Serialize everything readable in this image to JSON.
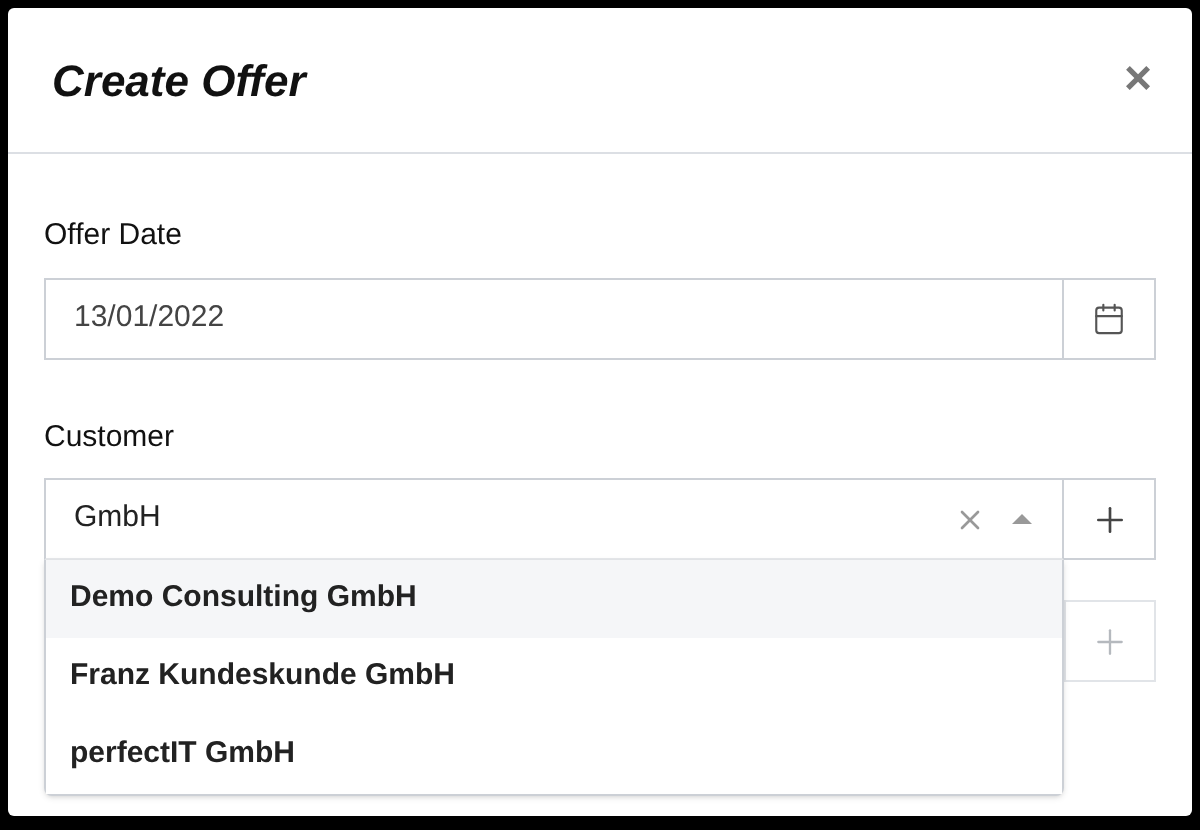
{
  "dialog": {
    "title": "Create Offer",
    "close": "×"
  },
  "offer_date": {
    "label": "Offer Date",
    "value": "13/01/2022"
  },
  "customer": {
    "label": "Customer",
    "value": "GmbH",
    "expanded": true,
    "options": [
      {
        "label": "Demo Consulting GmbH",
        "selected": true
      },
      {
        "label": "Franz Kundeskunde GmbH",
        "selected": false
      },
      {
        "label": "perfectIT GmbH",
        "selected": false
      }
    ]
  },
  "next_field": {
    "add_disabled": true
  }
}
